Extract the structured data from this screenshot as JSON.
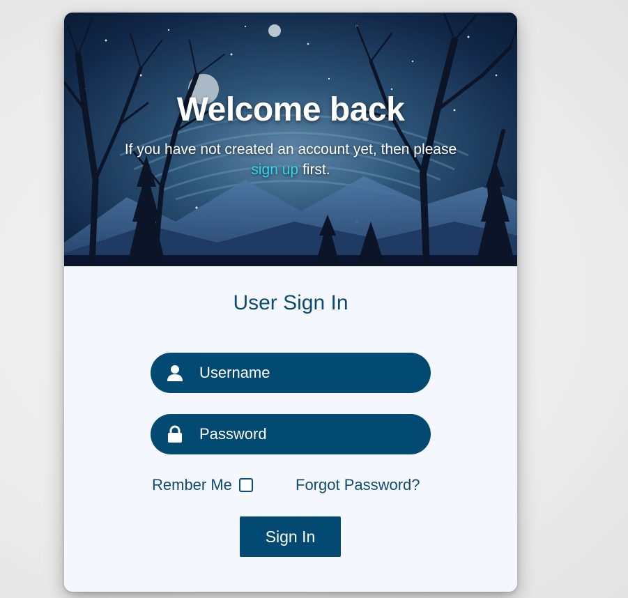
{
  "hero": {
    "title": "Welcome back",
    "subtitle_before": "If you have not created an account yet, then please ",
    "signup_link": "sign up",
    "subtitle_after": " first."
  },
  "form": {
    "title": "User Sign In",
    "username_placeholder": "Username",
    "password_placeholder": "Password",
    "remember_label": "Rember Me",
    "remember_checked": false,
    "forgot_label": "Forgot Password?",
    "submit_label": "Sign In"
  },
  "icons": {
    "username": "user-icon",
    "password": "lock-icon"
  },
  "colors": {
    "primary": "#034a72",
    "text": "#0e4b71",
    "link": "#2fd8f0",
    "card_bg": "#f4f7fd"
  }
}
